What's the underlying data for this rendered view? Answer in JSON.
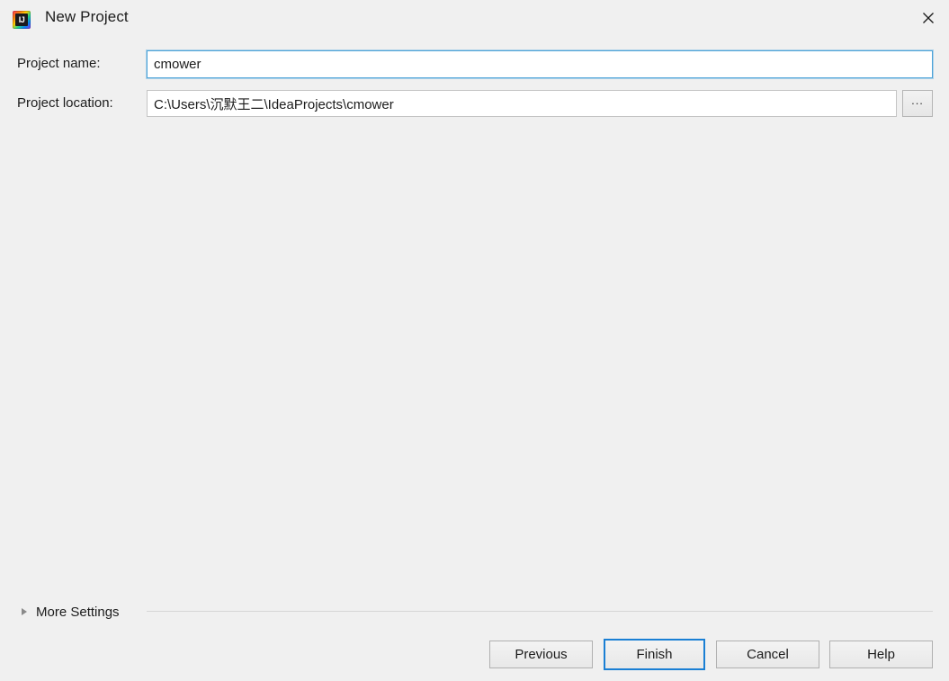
{
  "window": {
    "title": "New Project",
    "icon": "intellij-idea-icon",
    "icon_text": "IJ",
    "close_icon": "close-icon",
    "background_color": "#f0f0f0"
  },
  "form": {
    "fields": [
      {
        "label": "Project name:",
        "value": "cmower",
        "placeholder": "",
        "focused": true
      },
      {
        "label": "Project location:",
        "value": "C:\\Users\\沉默王二\\IdeaProjects\\cmower",
        "placeholder": "",
        "focused": false
      }
    ],
    "browse_button_label": "...",
    "focus_border_color": "#4da3d8"
  },
  "more_settings": {
    "label": "More Settings",
    "expanded": false,
    "disclosure_icon": "triangle-right-icon"
  },
  "buttons": {
    "previous": "Previous",
    "finish": "Finish",
    "cancel": "Cancel",
    "help": "Help",
    "default_button": "Finish",
    "default_border_color": "#1a7fd4"
  }
}
